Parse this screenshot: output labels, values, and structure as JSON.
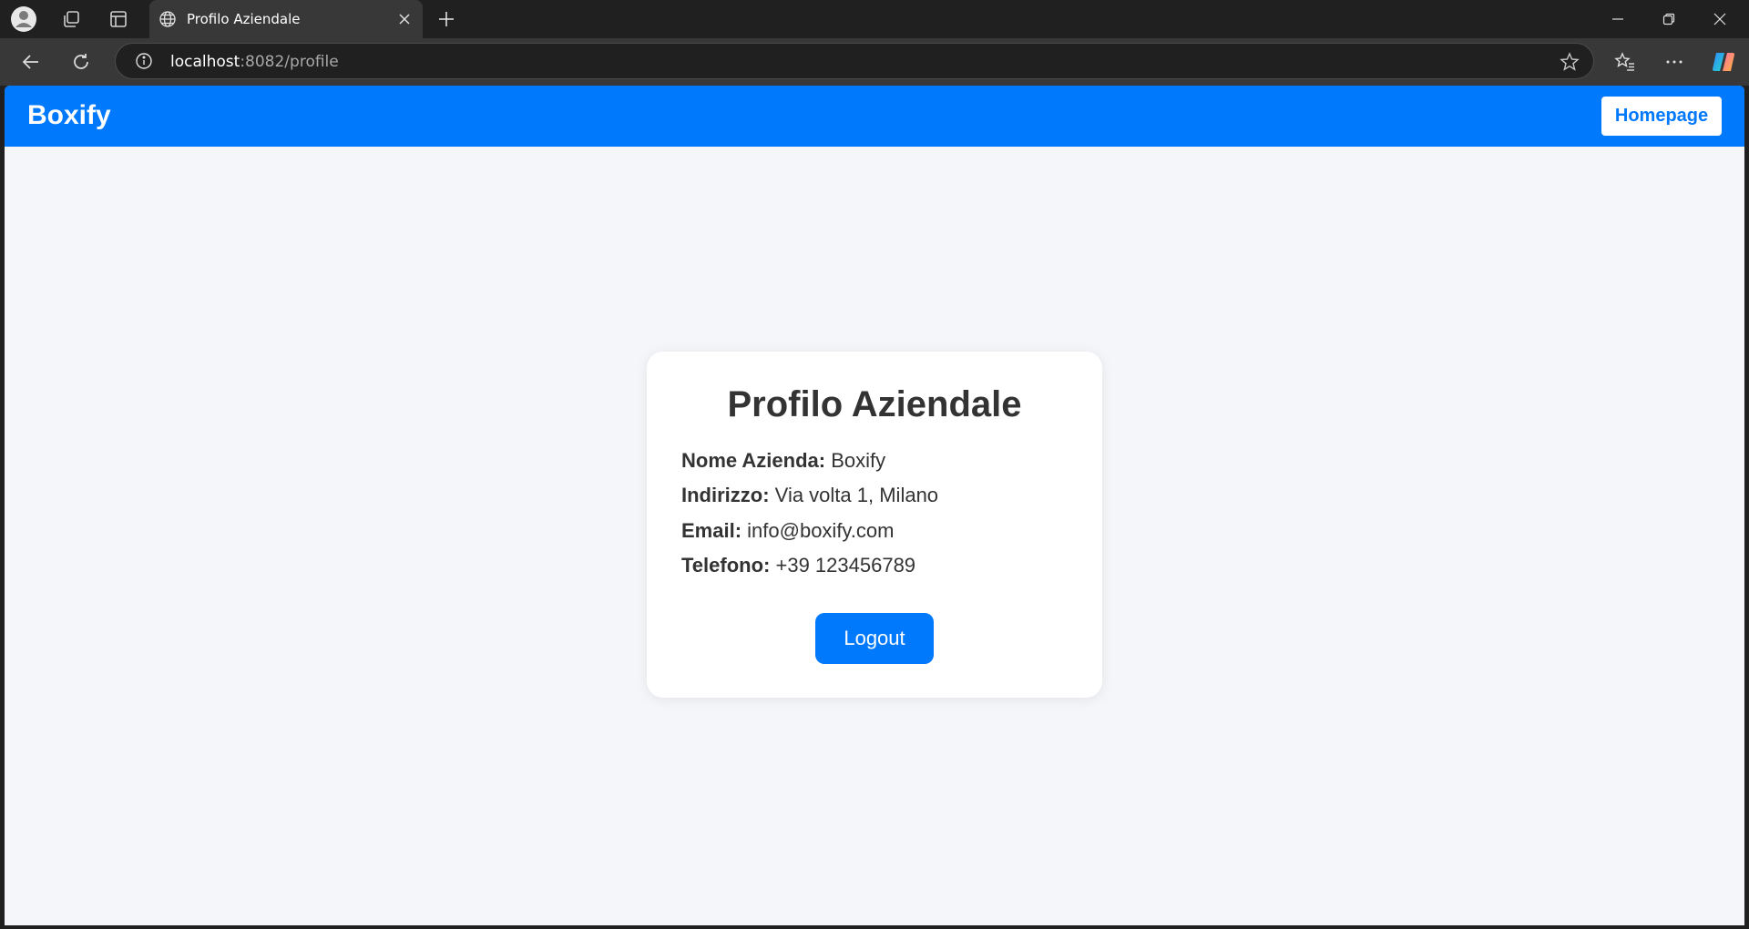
{
  "browser": {
    "tab": {
      "title": "Profilo Aziendale"
    },
    "address": {
      "host": "localhost",
      "rest": ":8082/profile"
    }
  },
  "header": {
    "brand": "Boxify",
    "homepage_label": "Homepage"
  },
  "profile": {
    "title": "Profilo Aziendale",
    "rows": [
      {
        "label": "Nome Azienda:",
        "value": "Boxify"
      },
      {
        "label": "Indirizzo:",
        "value": "Via volta 1, Milano"
      },
      {
        "label": "Email:",
        "value": "info@boxify.com"
      },
      {
        "label": "Telefono:",
        "value": "+39 123456789"
      }
    ],
    "logout_label": "Logout"
  },
  "colors": {
    "brand_blue": "#0079fd",
    "page_bg": "#f4f6f9",
    "text": "#333333"
  },
  "icons": [
    "profile-icon",
    "workspaces-icon",
    "tab-actions-icon",
    "globe-icon",
    "close-icon",
    "plus-icon",
    "minimize-icon",
    "restore-icon",
    "back-icon",
    "refresh-icon",
    "info-icon",
    "star-icon",
    "favorites-icon",
    "more-icon",
    "copilot-icon"
  ]
}
